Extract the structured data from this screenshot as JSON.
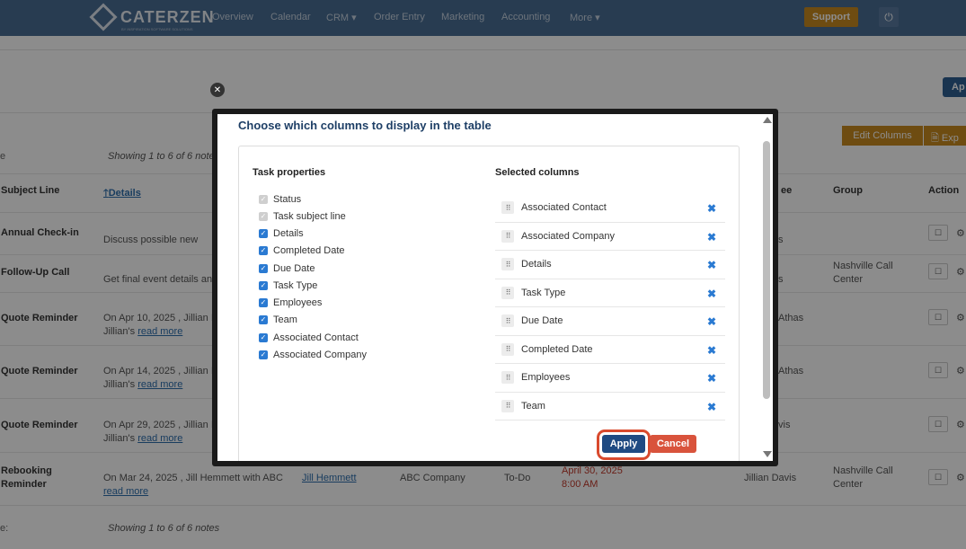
{
  "nav": {
    "logo": "CATERZEN",
    "logo_sub": "BY INSPIRATION SOFTWARE SOLUTIONS",
    "items": [
      "Overview",
      "Calendar",
      "CRM ▾",
      "Order Entry",
      "Marketing",
      "Accounting",
      "More ▾"
    ],
    "support": "Support"
  },
  "page": {
    "apply_btn": "Ap",
    "edit_columns": "Edit Columns",
    "export": "Exp",
    "showing_top": "Showing 1 to 6 of 6 notes",
    "showing_bottom": "Showing 1 to 6 of 6 notes",
    "left_e": "e",
    "left_e2": "e:",
    "headers": {
      "subject": "Subject Line",
      "details": "Details",
      "ee": "ee",
      "group": "Group",
      "action": "Action"
    },
    "rows": [
      {
        "subject": "Annual Check-in",
        "details1": "Discuss possible new",
        "details2": "",
        "link": "",
        "emp": "s",
        "group1": "",
        "group2": ""
      },
      {
        "subject": "Follow-Up Call",
        "details1": "Get final event details and",
        "details2": "",
        "link": "",
        "emp": "s",
        "group1": "Nashville Call",
        "group2": "Center"
      },
      {
        "subject": "Quote Reminder",
        "details1": "On Apr 10, 2025 , Jillian I",
        "details2": "Jillian's",
        "link": "read more",
        "emp": "Athas",
        "group1": "",
        "group2": ""
      },
      {
        "subject": "Quote Reminder",
        "details1": "On Apr 14, 2025 , Jillian I",
        "details2": "Jillian's",
        "link": "read more",
        "emp": "Athas",
        "group1": "",
        "group2": ""
      },
      {
        "subject": "Quote Reminder",
        "details1": "On Apr 29, 2025 , Jillian I",
        "details2": "Jillian's",
        "link": "read more",
        "emp": "vis",
        "group1": "",
        "group2": ""
      }
    ],
    "last_row": {
      "subject1": "Rebooking",
      "subject2": "Reminder",
      "details1": "On Mar 24, 2025 , Jill Hemmett with ABC",
      "link": "read more",
      "contact": "Jill Hemmett",
      "company": "ABC Company",
      "type": "To-Do",
      "date1": "April 30, 2025",
      "date2": "8:00 AM",
      "employee": "Jillian Davis",
      "group1": "Nashville Call",
      "group2": "Center"
    }
  },
  "modal": {
    "title": "Choose which columns to display in the table",
    "task_properties_heading": "Task properties",
    "selected_heading": "Selected columns",
    "properties": [
      {
        "label": "Status",
        "state": "disabled"
      },
      {
        "label": "Task subject line",
        "state": "disabled"
      },
      {
        "label": "Details",
        "state": "checked"
      },
      {
        "label": "Completed Date",
        "state": "checked"
      },
      {
        "label": "Due Date",
        "state": "checked"
      },
      {
        "label": "Task Type",
        "state": "checked"
      },
      {
        "label": "Employees",
        "state": "checked"
      },
      {
        "label": "Team",
        "state": "checked"
      },
      {
        "label": "Associated Contact",
        "state": "checked"
      },
      {
        "label": "Associated Company",
        "state": "checked"
      }
    ],
    "selected": [
      "Associated Contact",
      "Associated Company",
      "Details",
      "Task Type",
      "Due Date",
      "Completed Date",
      "Employees",
      "Team"
    ],
    "apply": "Apply",
    "cancel": "Cancel"
  },
  "colors": {
    "nav_bg": "#4a6d94",
    "accent_orange": "#c98a1f",
    "apply_blue": "#1f4a82",
    "cancel_red": "#d9533c",
    "highlight_ring": "#d94a2e",
    "checkbox_blue": "#2a7ad2"
  }
}
